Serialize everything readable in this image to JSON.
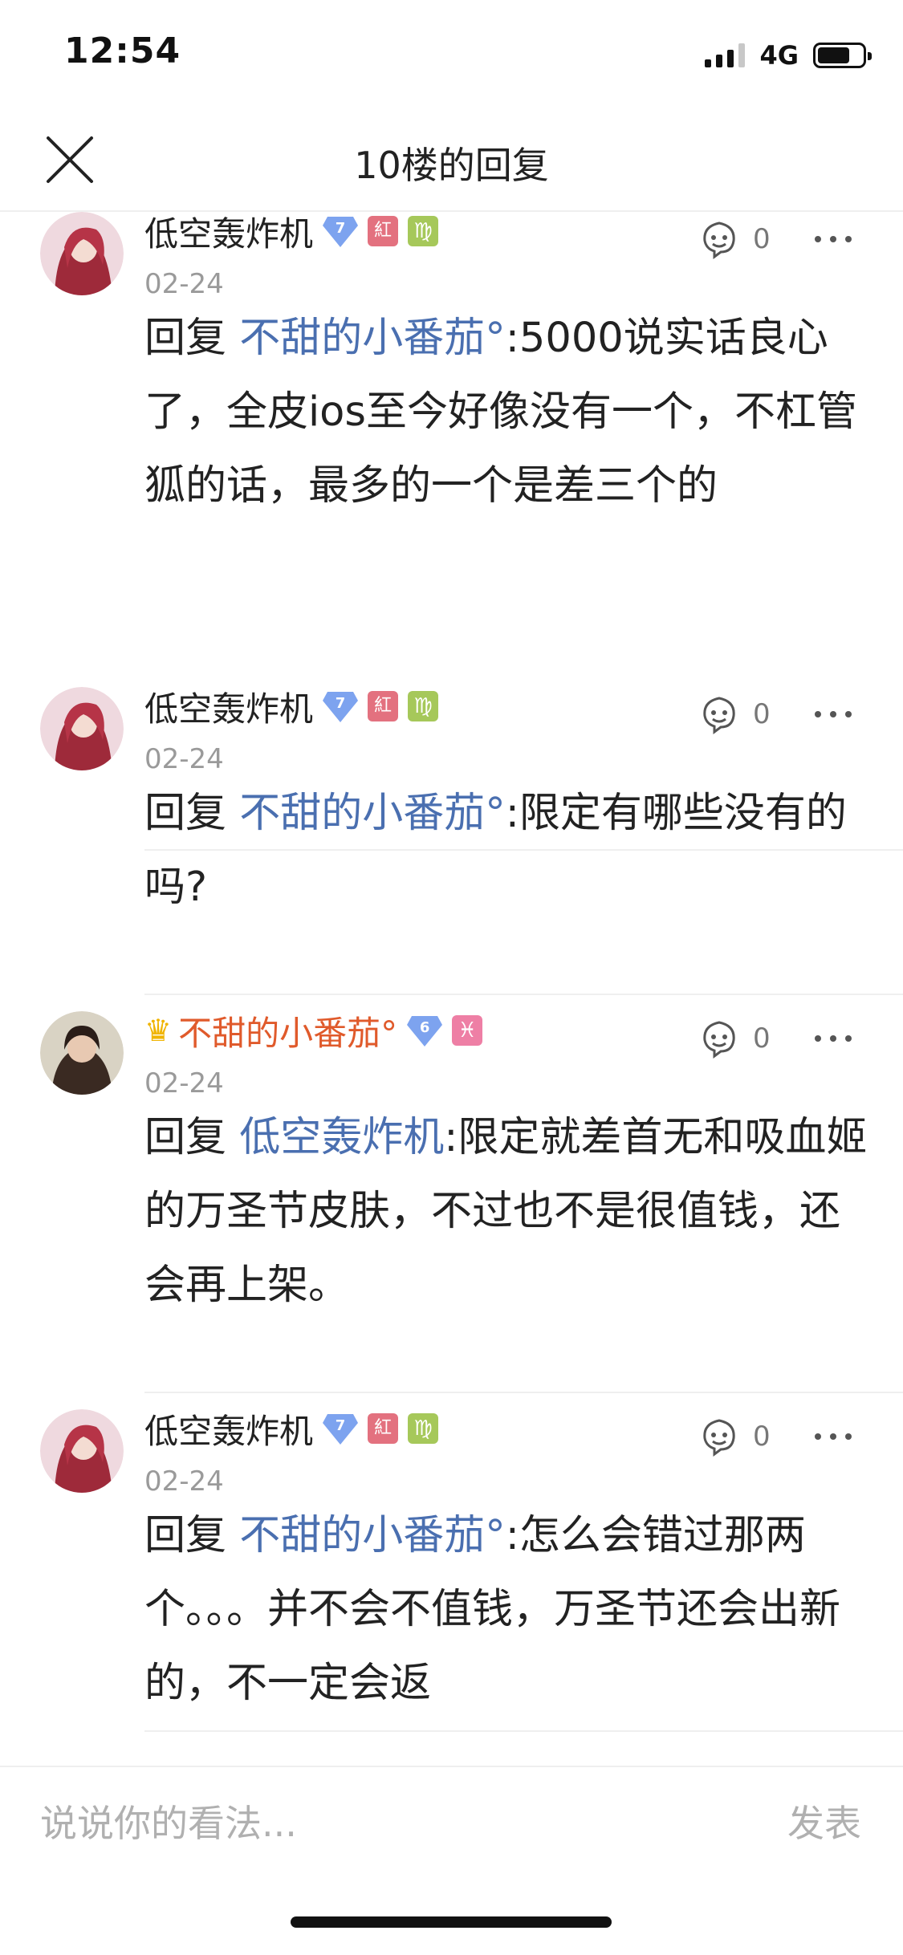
{
  "status_bar": {
    "time": "12:54",
    "network": "4G",
    "battery_level": 0.72
  },
  "header": {
    "title": "10楼的回复",
    "close_icon": "close-icon"
  },
  "comments": [
    {
      "username": "低空轰炸机",
      "level": "7",
      "badges": [
        "紅",
        "♍"
      ],
      "date": "02-24",
      "likes": "0",
      "reply_prefix": "回复",
      "mention": "不甜的小番茄°",
      "text": ":5000说实话良心了，全皮ios至今好像没有一个，不杠管狐的话，最多的一个是差三个的"
    },
    {
      "username": "低空轰炸机",
      "level": "7",
      "badges": [
        "紅",
        "♍"
      ],
      "date": "02-24",
      "likes": "0",
      "reply_prefix": "回复",
      "mention": "不甜的小番茄°",
      "text": ":限定有哪些没有的吗?"
    },
    {
      "username": "不甜的小番茄°",
      "is_op": true,
      "crown_icon": "crown-icon",
      "level": "6",
      "badges": [
        "♓"
      ],
      "date": "02-24",
      "likes": "0",
      "reply_prefix": "回复",
      "mention": "低空轰炸机",
      "text": ":限定就差首无和吸血姬的万圣节皮肤，不过也不是很值钱，还会再上架。"
    },
    {
      "username": "低空轰炸机",
      "level": "7",
      "badges": [
        "紅",
        "♍"
      ],
      "date": "02-24",
      "likes": "0",
      "reply_prefix": "回复",
      "mention": "不甜的小番茄°",
      "text": ":怎么会错过那两个。。。并不会不值钱，万圣节还会出新的，不一定会返"
    }
  ],
  "input": {
    "placeholder": "说说你的看法...",
    "send_label": "发表"
  },
  "colors": {
    "mention": "#4a6fb0",
    "op_name": "#e05a2b",
    "muted": "#9a9a9a"
  }
}
